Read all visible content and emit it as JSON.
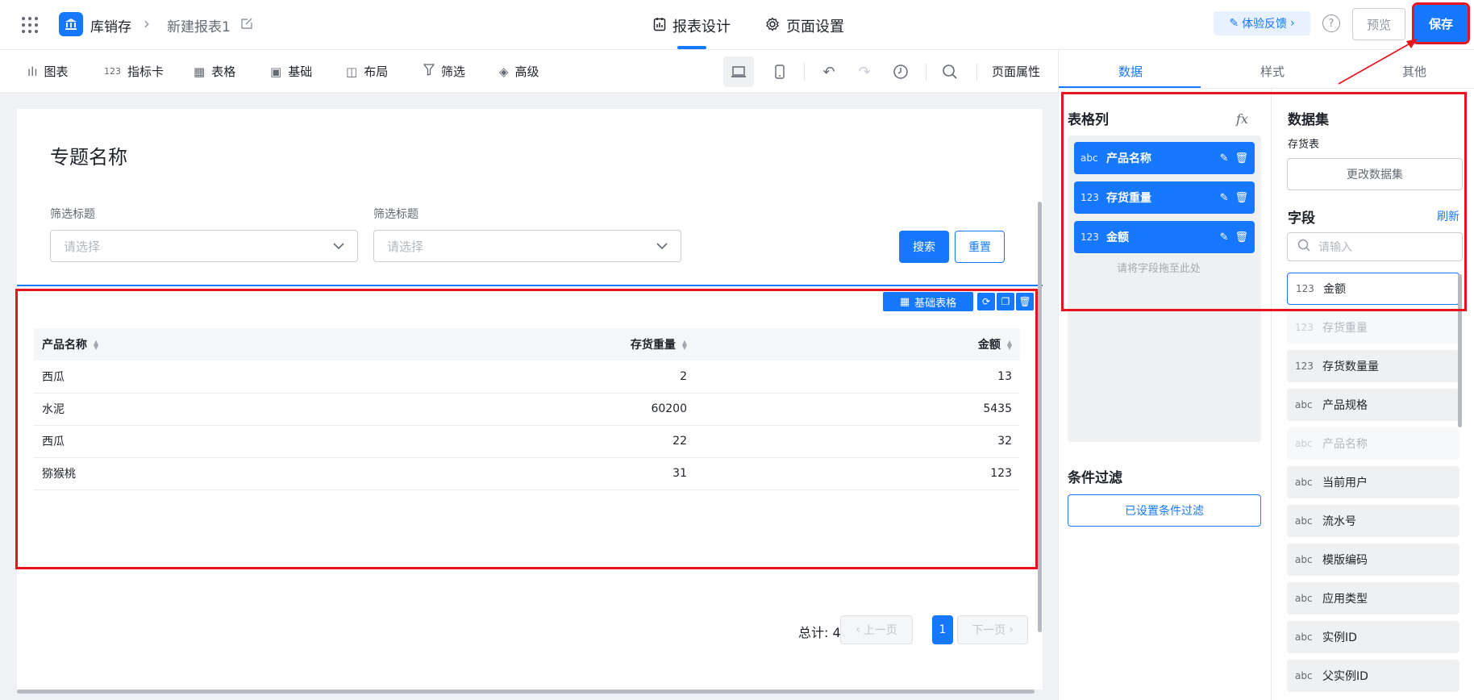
{
  "header": {
    "app_name": "库销存",
    "report_name": "新建报表1",
    "tabs": [
      "报表设计",
      "页面设置"
    ],
    "feedback": "体验反馈",
    "help": "?",
    "preview": "预览",
    "save": "保存"
  },
  "toolbar": {
    "items": [
      {
        "icon": "bar-chart-icon",
        "glyph": "ılı",
        "label": "图表"
      },
      {
        "icon": "metric-card-icon",
        "glyph": "123",
        "label": "指标卡"
      },
      {
        "icon": "table-icon",
        "glyph": "▦",
        "label": "表格"
      },
      {
        "icon": "basic-icon",
        "glyph": "▣",
        "label": "基础"
      },
      {
        "icon": "layout-icon",
        "glyph": "◫",
        "label": "布局"
      },
      {
        "icon": "filter-icon",
        "glyph": "⏚",
        "label": "筛选"
      },
      {
        "icon": "layers-icon",
        "glyph": "◈",
        "label": "高级"
      }
    ],
    "page_props": "页面属性"
  },
  "canvas": {
    "page_title": "专题名称",
    "filters": [
      {
        "label": "筛选标题",
        "placeholder": "请选择"
      },
      {
        "label": "筛选标题",
        "placeholder": "请选择"
      }
    ],
    "search": "搜索",
    "reset": "重置",
    "component_tag": "基础表格",
    "table": {
      "columns": [
        "产品名称",
        "存货重量",
        "金额"
      ],
      "rows": [
        [
          "西瓜",
          "2",
          "13"
        ],
        [
          "水泥",
          "60200",
          "5435"
        ],
        [
          "西瓜",
          "22",
          "32"
        ],
        [
          "猕猴桃",
          "31",
          "123"
        ]
      ]
    },
    "total": "总计: 4",
    "prev": "上一页",
    "page": "1",
    "next": "下一页"
  },
  "panel": {
    "tabs": [
      "数据",
      "样式",
      "其他"
    ],
    "columns_title": "表格列",
    "columns": [
      {
        "type": "abc",
        "name": "产品名称"
      },
      {
        "type": "123",
        "name": "存货重量"
      },
      {
        "type": "123",
        "name": "金额"
      }
    ],
    "drop_hint": "请将字段拖至此处",
    "filter_title": "条件过滤",
    "filter_btn": "已设置条件过滤",
    "dataset_title": "数据集",
    "dataset_name": "存货表",
    "change_dataset": "更改数据集",
    "fields_title": "字段",
    "refresh": "刷新",
    "search_placeholder": "请输入",
    "fields": [
      {
        "type": "123",
        "name": "金额",
        "state": "selected"
      },
      {
        "type": "123",
        "name": "存货重量",
        "state": "dim"
      },
      {
        "type": "123",
        "name": "存货数量量",
        "state": "normal"
      },
      {
        "type": "abc",
        "name": "产品规格",
        "state": "normal"
      },
      {
        "type": "abc",
        "name": "产品名称",
        "state": "dim"
      },
      {
        "type": "abc",
        "name": "当前用户",
        "state": "normal"
      },
      {
        "type": "abc",
        "name": "流水号",
        "state": "normal"
      },
      {
        "type": "abc",
        "name": "模版编码",
        "state": "normal"
      },
      {
        "type": "abc",
        "name": "应用类型",
        "state": "normal"
      },
      {
        "type": "abc",
        "name": "实例ID",
        "state": "normal"
      },
      {
        "type": "abc",
        "name": "父实例ID",
        "state": "normal"
      }
    ]
  },
  "colors": {
    "primary": "#1677ff",
    "highlight": "#e6141e"
  }
}
